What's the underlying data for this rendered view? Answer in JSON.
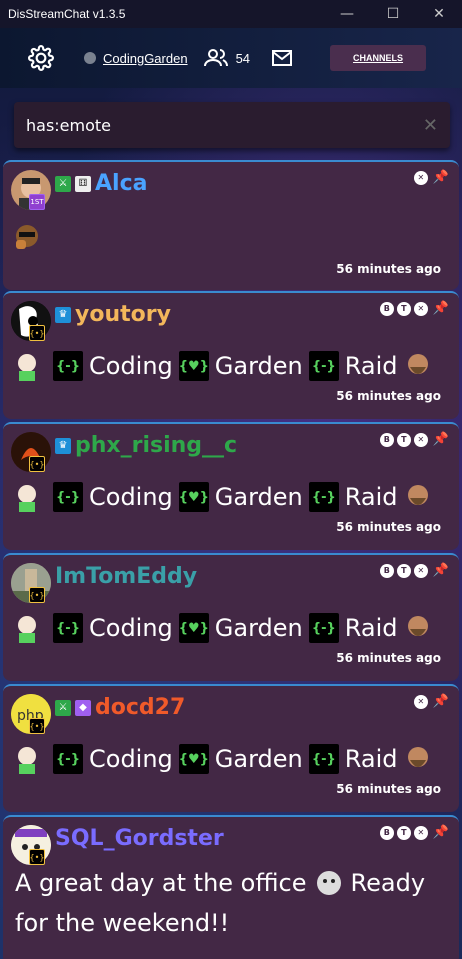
{
  "window": {
    "title": "DisStreamChat v1.3.5"
  },
  "header": {
    "channel_name": "CodingGarden",
    "viewer_count": "54",
    "channels_button": "CHANNELS",
    "status_color": "#7a8290"
  },
  "filter": {
    "value": "has:emote"
  },
  "messages": [
    {
      "username": "Alca",
      "name_color": "#4aa3ff",
      "rank_badge": "1ST",
      "actions": [
        "x"
      ],
      "body_emote": "fist-emote",
      "timestamp": "56 minutes ago"
    },
    {
      "username": "youtory",
      "name_color": "#f3b75b",
      "actions": [
        "B",
        "T",
        "x"
      ],
      "body_words": [
        "Coding",
        "Garden",
        "Raid"
      ],
      "timestamp": "56 minutes ago"
    },
    {
      "username": "phx_rising__c",
      "name_color": "#2ea84a",
      "actions": [
        "B",
        "T",
        "x"
      ],
      "body_words": [
        "Coding",
        "Garden",
        "Raid"
      ],
      "timestamp": "56 minutes ago"
    },
    {
      "username": "ImTomEddy",
      "name_color": "#3aa0a8",
      "actions": [
        "B",
        "T",
        "x"
      ],
      "body_words": [
        "Coding",
        "Garden",
        "Raid"
      ],
      "timestamp": "56 minutes ago"
    },
    {
      "username": "docd27",
      "name_color": "#f05a2a",
      "actions": [
        "x"
      ],
      "body_words": [
        "Coding",
        "Garden",
        "Raid"
      ],
      "timestamp": "56 minutes ago"
    },
    {
      "username": "SQL_Gordster",
      "name_color": "#7a6cff",
      "actions": [
        "B",
        "T",
        "x"
      ],
      "body_text_1": "A great day at the office",
      "body_text_2": "Ready",
      "body_text_3": "for the weekend!!"
    }
  ]
}
